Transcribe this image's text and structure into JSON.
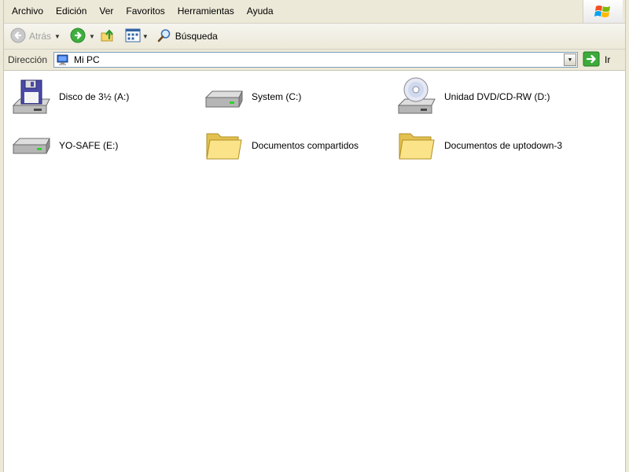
{
  "menubar": {
    "items": [
      "Archivo",
      "Edición",
      "Ver",
      "Favoritos",
      "Herramientas",
      "Ayuda"
    ]
  },
  "toolbar": {
    "back_label": "Atrás",
    "search_label": "Búsqueda"
  },
  "address": {
    "label": "Dirección",
    "value": "Mi PC",
    "go_label": "Ir"
  },
  "items": [
    {
      "name": "Disco de 3½ (A:)",
      "icon": "floppy-drive-icon"
    },
    {
      "name": "System (C:)",
      "icon": "hard-drive-icon"
    },
    {
      "name": "Unidad DVD/CD-RW (D:)",
      "icon": "dvd-drive-icon"
    },
    {
      "name": "YO-SAFE (E:)",
      "icon": "removable-drive-icon"
    },
    {
      "name": "Documentos compartidos",
      "icon": "folder-icon"
    },
    {
      "name": "Documentos de uptodown-3",
      "icon": "folder-icon"
    }
  ]
}
